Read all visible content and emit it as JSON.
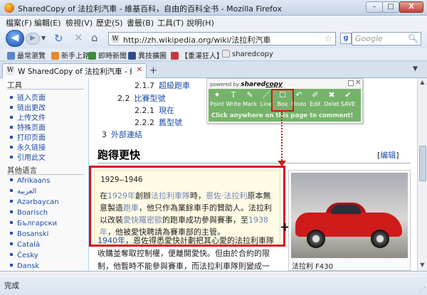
{
  "window": {
    "title": "SharedCopy of 法拉利汽車 - 維基百科，自由的百科全书 - Mozilla Firefox",
    "min": "–",
    "max": "□",
    "close": "X"
  },
  "menu": [
    "檔案(F)",
    "編輯(E)",
    "檢視(V)",
    "歷史(S)",
    "書籤(B)",
    "工具(T)",
    "說明(H)"
  ],
  "nav": {
    "url": "http://zh.wikipedia.org/wiki/法拉利汽車",
    "site_icon": "W",
    "search_placeholder": "Google",
    "search_engine_icon": "g"
  },
  "bookmarks": [
    "最常瀏覽",
    "新手上路",
    "即時新聞",
    "異技擴圖",
    "【重灌狂人】",
    "sharedcopy"
  ],
  "tab": {
    "favicon": "W",
    "title": "W SharedCopy of 法拉利汽車 - 維基百...",
    "new": "+"
  },
  "sidebar": {
    "tools_heading": "工具",
    "tools": [
      "链入页面",
      "链出更改",
      "上传文件",
      "特殊页面",
      "打印页面",
      "永久链接",
      "引用此文"
    ],
    "lang_heading": "其他语言",
    "langs": [
      "Afrikaans",
      "العربية",
      "Azərbaycan",
      "Boarisch",
      "Български",
      "Bosanski",
      "Català",
      "Česky",
      "Dansk"
    ]
  },
  "toc": [
    {
      "num": "2.1.7",
      "label": "超級跑車"
    },
    {
      "num": "2.2",
      "label": "比賽型號"
    },
    {
      "num": "2.2.1",
      "label": "現在"
    },
    {
      "num": "2.2.2",
      "label": "舊型號"
    },
    {
      "num": "3",
      "label": "外部連結"
    }
  ],
  "section": {
    "heading": "跑得更快",
    "edit": "编辑",
    "year_range": "1929–1946"
  },
  "paragraph1": {
    "l1a": "在",
    "l1b": "1929年",
    "l1c": "創辦",
    "l1d": "法拉利車隊",
    "l1e": "時，",
    "l1f": "恩佐·法拉利",
    "l1g": "原本無",
    "l2a": "意製造",
    "l2b": "跑車",
    "l2c": "，他只作為業餘車手的贊助人。法拉利",
    "l3a": "以改裝",
    "l3b": "愛快羅密歐",
    "l3c": "的跑車成功參與賽事，至",
    "l3d": "1938",
    "l4a": "年",
    "l4b": "，他被愛快聘請為賽車部的主管。"
  },
  "paragraph2": {
    "l1a": "1940年",
    "l1b": "，恩佐得悉愛快計劃把其心愛的法拉利車隊",
    "l2": "收購並奪取控制權，便離開愛快。但由於合約的限",
    "l3": "制，他暫時不能參與賽車，而法拉利車隊則變成一"
  },
  "photo_caption": "法拉利 F430",
  "sharedcopy": {
    "powered": "powered by",
    "brand_a": "shared",
    "brand_b": "copy",
    "hint": "Click anywhere on this page to comment!",
    "tools": [
      {
        "icon": "pin-icon",
        "glyph": "✦",
        "label": "Point"
      },
      {
        "icon": "text-icon",
        "glyph": "T",
        "label": "Write"
      },
      {
        "icon": "pen-icon",
        "glyph": "✎",
        "label": "Mark"
      },
      {
        "icon": "line-icon",
        "glyph": "／",
        "label": "Line"
      },
      {
        "icon": "box-icon",
        "glyph": "☐",
        "label": "Box"
      },
      {
        "icon": "undo-icon",
        "glyph": "↶",
        "label": "Undo"
      },
      {
        "icon": "edit-icon",
        "glyph": "✐",
        "label": "Edit"
      },
      {
        "icon": "delete-icon",
        "glyph": "✖",
        "label": "Delet"
      },
      {
        "icon": "check-icon",
        "glyph": "✔",
        "label": "SAVE"
      }
    ]
  },
  "status": "完成",
  "colors": {
    "accent_red": "#d2141b",
    "toolbar_green": "#75b36a",
    "link": "#1f4ea8"
  }
}
